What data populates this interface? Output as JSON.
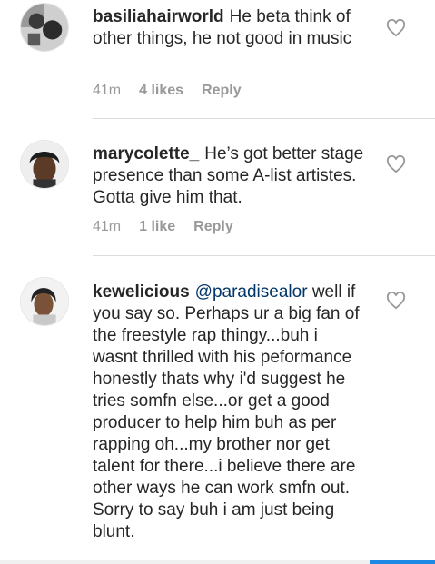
{
  "comments": [
    {
      "username": "basiliahairworld",
      "text": "He beta think of other things, he not good in music",
      "time": "41m",
      "likes": "4 likes",
      "reply": "Reply"
    },
    {
      "username": "marycolette_",
      "text": "He’s got better stage presence than some A-list artistes. Gotta give him that.",
      "time": "41m",
      "likes": "1 like",
      "reply": "Reply"
    },
    {
      "username": "kewelicious",
      "mention": "@paradisealor",
      "text": "well if you say so. Perhaps ur a big fan of the freestyle rap thingy...buh i wasnt thrilled with his peformance honestly thats why i'd suggest he tries somfn else...or get a good producer to help him buh as per rapping oh...my brother nor get talent for there...i believe there are other ways he can work smfn out. Sorry to say buh i am just being blunt."
    }
  ],
  "icons": {
    "like": "heart-outline-icon"
  },
  "colors": {
    "text": "#262626",
    "meta": "#999999",
    "mention": "#003569",
    "accent": "#1e88e5"
  }
}
